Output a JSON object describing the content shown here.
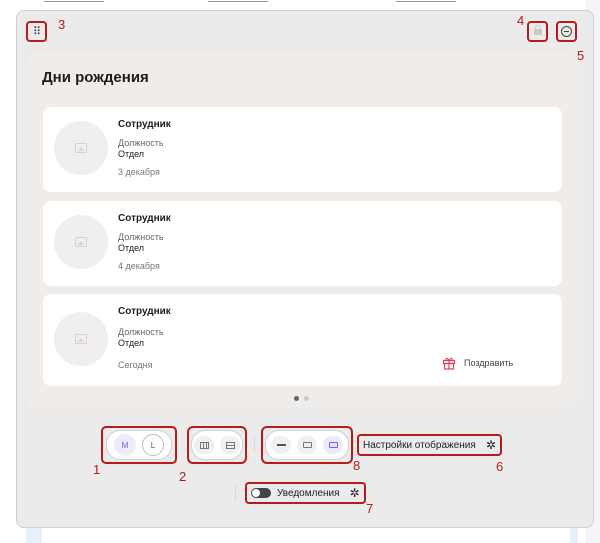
{
  "widget": {
    "title": "Дни рождения",
    "cards": [
      {
        "name": "Сотрудник",
        "position": "Должность",
        "department": "Отдел",
        "date": "3 декабря",
        "action": ""
      },
      {
        "name": "Сотрудник",
        "position": "Должность",
        "department": "Отдел",
        "date": "4 декабря",
        "action": ""
      },
      {
        "name": "Сотрудник",
        "position": "Должность",
        "department": "Отдел",
        "date": "Сегодня",
        "action": "Поздравить"
      }
    ],
    "pagination": {
      "pages": 2,
      "current": 1
    }
  },
  "toolbar": {
    "size_options": [
      "M",
      "L"
    ],
    "selected_size": "M",
    "settings_label": "Настройки отображения",
    "notifications_label": "Уведомления",
    "notifications_enabled": false
  },
  "annotations": [
    "1",
    "2",
    "3",
    "4",
    "5",
    "6",
    "7",
    "8"
  ],
  "colors": {
    "annotation": "#b71c1c",
    "accent": "#6f5fd0",
    "gift": "#e0405a"
  },
  "icons": [
    "drag-handle-icon",
    "lock-icon",
    "minus-circle-icon",
    "image-placeholder-icon",
    "gift-icon",
    "columns-icon",
    "rows-icon",
    "dash-icon",
    "dense-icon",
    "gear-icon",
    "toggle-icon"
  ]
}
